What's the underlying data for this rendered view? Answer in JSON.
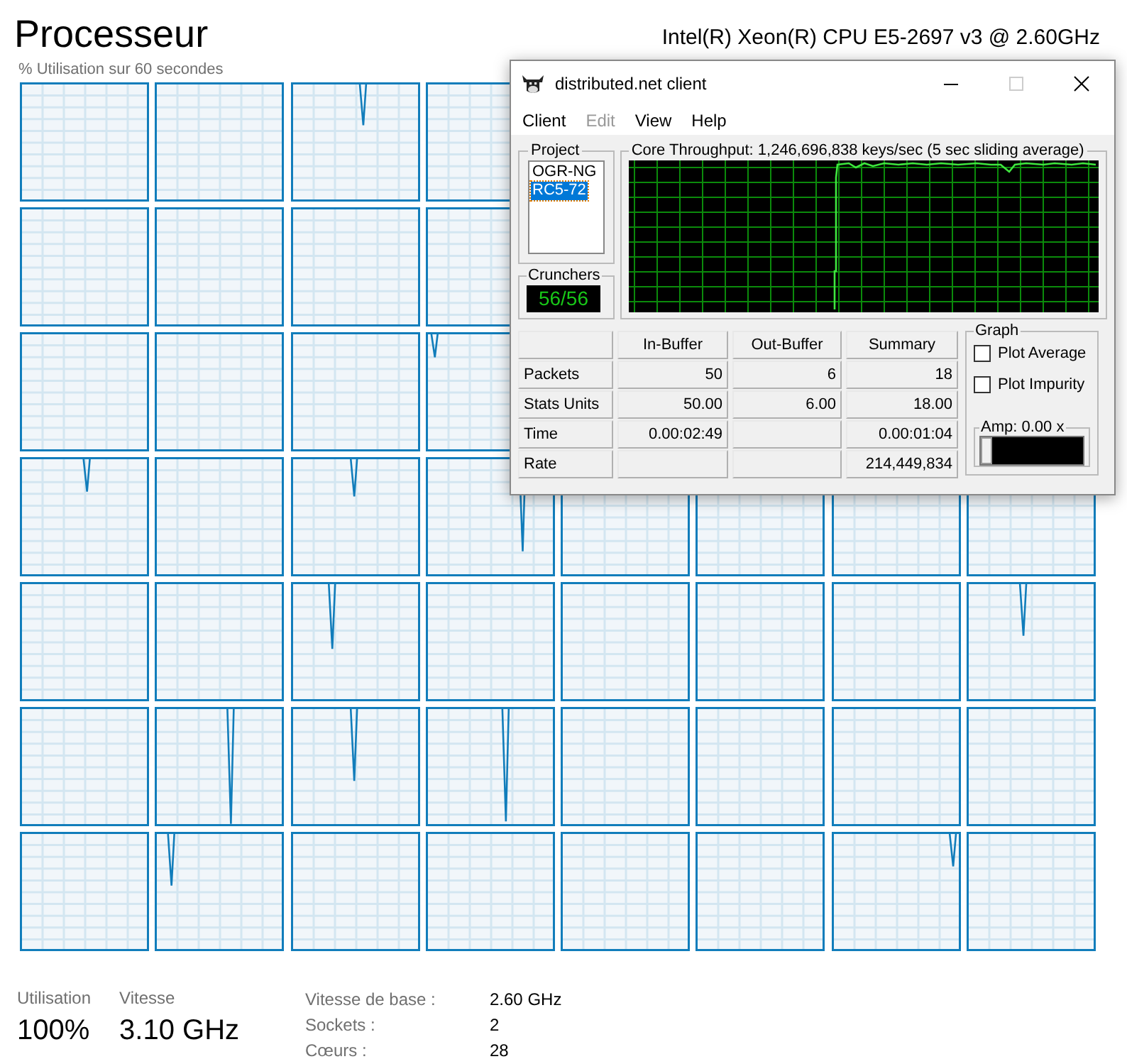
{
  "title": "Processeur",
  "cpu_model": "Intel(R) Xeon(R) CPU E5-2697 v3 @ 2.60GHz",
  "graph_caption": "% Utilisation sur 60 secondes",
  "stats": [
    {
      "label": "Utilisation",
      "value": "100%"
    },
    {
      "label": "Vitesse",
      "value": "3.10 GHz"
    }
  ],
  "details": [
    {
      "label": "Vitesse de base :",
      "value": "2.60 GHz"
    },
    {
      "label": "Sockets :",
      "value": "2"
    },
    {
      "label": "Cœurs :",
      "value": "28"
    }
  ],
  "client_window": {
    "title": "distributed.net client",
    "menu": [
      {
        "label": "Client",
        "disabled": false
      },
      {
        "label": "Edit",
        "disabled": true
      },
      {
        "label": "View",
        "disabled": false
      },
      {
        "label": "Help",
        "disabled": false
      }
    ],
    "project": {
      "label": "Project",
      "items": [
        {
          "label": "OGR-NG",
          "selected": false
        },
        {
          "label": "RC5-72",
          "selected": true
        }
      ]
    },
    "crunchers": {
      "label": "Crunchers",
      "value": "56/56"
    },
    "throughput": {
      "label": "Core Throughput: 1,246,696,838 keys/sec (5 sec sliding average)"
    },
    "table": {
      "columns": [
        "In-Buffer",
        "Out-Buffer",
        "Summary"
      ],
      "rows": [
        {
          "label": "Packets",
          "cells": [
            "50",
            "6",
            "18"
          ]
        },
        {
          "label": "Stats Units",
          "cells": [
            "50.00",
            "6.00",
            "18.00"
          ]
        },
        {
          "label": "Time",
          "cells": [
            "0.00:02:49",
            null,
            "0.00:01:04"
          ]
        },
        {
          "label": "Rate",
          "cells": [
            null,
            null,
            "214,449,834"
          ]
        }
      ]
    },
    "graph": {
      "label": "Graph",
      "options": [
        {
          "label": "Plot Average",
          "checked": false
        },
        {
          "label": "Plot Impurity",
          "checked": false
        }
      ],
      "amp": {
        "label": "Amp: 0.00 x",
        "level": 0
      }
    }
  }
}
